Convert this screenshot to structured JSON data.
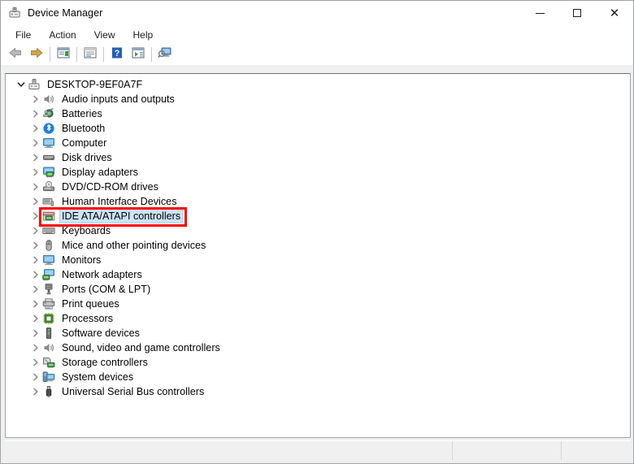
{
  "window": {
    "title": "Device Manager",
    "title_icon": "device-manager-icon",
    "controls": {
      "minimize": "—",
      "maximize": "□",
      "close": "✕",
      "minimize_name": "minimize-button",
      "maximize_name": "maximize-button",
      "close_name": "close-button"
    }
  },
  "menubar": {
    "items": [
      {
        "label": "File",
        "name": "menu-file"
      },
      {
        "label": "Action",
        "name": "menu-action"
      },
      {
        "label": "View",
        "name": "menu-view"
      },
      {
        "label": "Help",
        "name": "menu-help"
      }
    ]
  },
  "toolbar": {
    "buttons": [
      {
        "name": "back-button",
        "icon": "back-arrow-icon",
        "tooltip": "Back"
      },
      {
        "name": "forward-button",
        "icon": "forward-arrow-icon",
        "tooltip": "Forward"
      },
      {
        "name": "show-hide-console-tree-button",
        "icon": "console-tree-icon",
        "tooltip": "Show/Hide Console Tree"
      },
      {
        "name": "properties-button",
        "icon": "properties-icon",
        "tooltip": "Properties"
      },
      {
        "name": "help-button",
        "icon": "help-question-icon",
        "tooltip": "Help"
      },
      {
        "name": "update-driver-button",
        "icon": "update-driver-icon",
        "tooltip": "Update driver"
      },
      {
        "name": "scan-hardware-changes-button",
        "icon": "scan-hardware-icon",
        "tooltip": "Scan for hardware changes"
      }
    ]
  },
  "tree": {
    "root": {
      "label": "DESKTOP-9EF0A7F",
      "icon": "computer-root-icon",
      "expanded": true,
      "chevron": "chevron-down-icon"
    },
    "items": [
      {
        "label": "Audio inputs and outputs",
        "icon": "speaker-icon",
        "name": "tree-item-audio-inputs-and-outputs",
        "selected": false,
        "annotated": false
      },
      {
        "label": "Batteries",
        "icon": "battery-icon",
        "name": "tree-item-batteries",
        "selected": false,
        "annotated": false
      },
      {
        "label": "Bluetooth",
        "icon": "bluetooth-icon",
        "name": "tree-item-bluetooth",
        "selected": false,
        "annotated": false
      },
      {
        "label": "Computer",
        "icon": "monitor-icon",
        "name": "tree-item-computer",
        "selected": false,
        "annotated": false
      },
      {
        "label": "Disk drives",
        "icon": "disk-drive-icon",
        "name": "tree-item-disk-drives",
        "selected": false,
        "annotated": false
      },
      {
        "label": "Display adapters",
        "icon": "display-adapter-icon",
        "name": "tree-item-display-adapters",
        "selected": false,
        "annotated": false
      },
      {
        "label": "DVD/CD-ROM drives",
        "icon": "dvd-drive-icon",
        "name": "tree-item-dvd-cd-rom-drives",
        "selected": false,
        "annotated": false
      },
      {
        "label": "Human Interface Devices",
        "icon": "hid-icon",
        "name": "tree-item-human-interface-devices",
        "selected": false,
        "annotated": false
      },
      {
        "label": "IDE ATA/ATAPI controllers",
        "icon": "ide-controller-icon",
        "name": "tree-item-ide-ata-atapi-controllers",
        "selected": true,
        "annotated": true
      },
      {
        "label": "Keyboards",
        "icon": "keyboard-icon",
        "name": "tree-item-keyboards",
        "selected": false,
        "annotated": false
      },
      {
        "label": "Mice and other pointing devices",
        "icon": "mouse-icon",
        "name": "tree-item-mice-and-other-pointing-devices",
        "selected": false,
        "annotated": false
      },
      {
        "label": "Monitors",
        "icon": "monitor-icon",
        "name": "tree-item-monitors",
        "selected": false,
        "annotated": false
      },
      {
        "label": "Network adapters",
        "icon": "network-adapter-icon",
        "name": "tree-item-network-adapters",
        "selected": false,
        "annotated": false
      },
      {
        "label": "Ports (COM & LPT)",
        "icon": "port-icon",
        "name": "tree-item-ports-com-and-lpt",
        "selected": false,
        "annotated": false
      },
      {
        "label": "Print queues",
        "icon": "printer-icon",
        "name": "tree-item-print-queues",
        "selected": false,
        "annotated": false
      },
      {
        "label": "Processors",
        "icon": "processor-icon",
        "name": "tree-item-processors",
        "selected": false,
        "annotated": false
      },
      {
        "label": "Software devices",
        "icon": "software-device-icon",
        "name": "tree-item-software-devices",
        "selected": false,
        "annotated": false
      },
      {
        "label": "Sound, video and game controllers",
        "icon": "speaker-icon",
        "name": "tree-item-sound-video-and-game-controllers",
        "selected": false,
        "annotated": false
      },
      {
        "label": "Storage controllers",
        "icon": "storage-controller-icon",
        "name": "tree-item-storage-controllers",
        "selected": false,
        "annotated": false
      },
      {
        "label": "System devices",
        "icon": "system-device-icon",
        "name": "tree-item-system-devices",
        "selected": false,
        "annotated": false
      },
      {
        "label": "Universal Serial Bus controllers",
        "icon": "usb-icon",
        "name": "tree-item-universal-serial-bus-controllers",
        "selected": false,
        "annotated": false
      }
    ],
    "child_chevron": "chevron-right-icon"
  },
  "annotation": {
    "color": "#ff0000",
    "target": "IDE ATA/ATAPI controllers"
  },
  "statusbar": {
    "panes": [
      {
        "text": "",
        "name": "status-pane-main"
      },
      {
        "text": "",
        "name": "status-pane-second"
      },
      {
        "text": "",
        "name": "status-pane-third"
      }
    ]
  },
  "colors": {
    "selection": "#cce4f7",
    "annotation": "#ff0000",
    "panel_border": "#9fa4a8",
    "window_bg": "#f0f0f0"
  }
}
